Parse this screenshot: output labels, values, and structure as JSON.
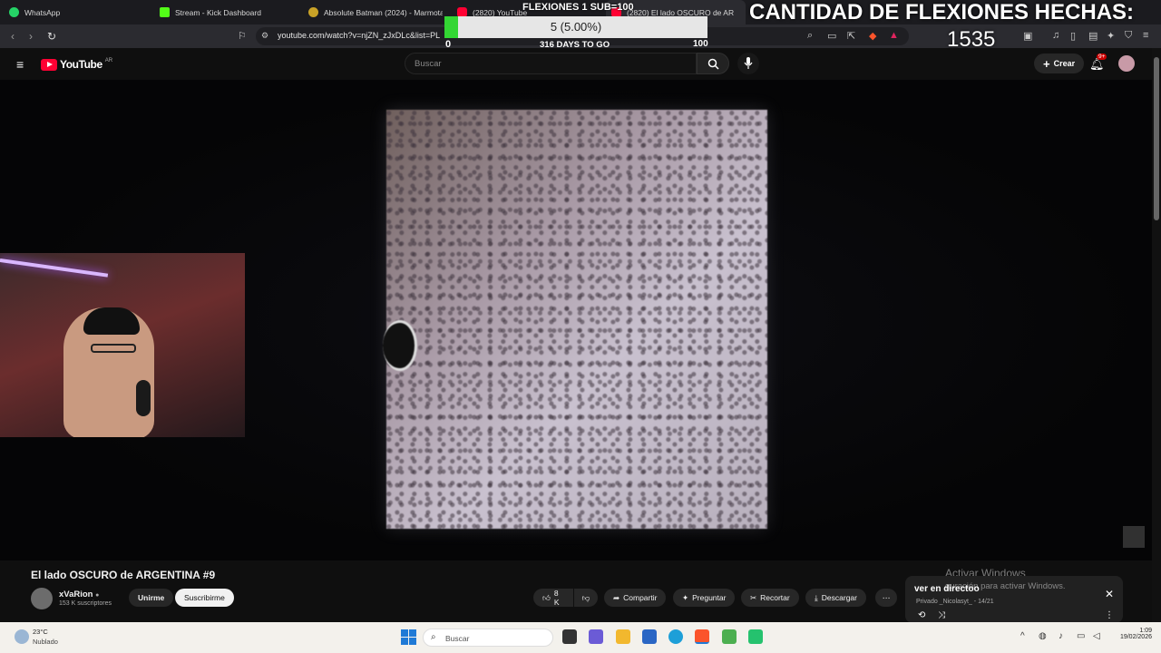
{
  "browser": {
    "tabs": [
      {
        "label": "WhatsApp",
        "color": "#25d366",
        "active": false
      },
      {
        "label": "Stream - Kick Dashboard",
        "color": "#53fc18",
        "active": false
      },
      {
        "label": "Absolute Batman (2024) - Marmota",
        "color": "#c9a227",
        "active": false
      },
      {
        "label": "(2820) YouTube",
        "color": "#ff0033",
        "active": false
      },
      {
        "label": "(2820) El lado OSCURO de AR",
        "color": "#ff0033",
        "active": true
      }
    ],
    "tab_close": "✕",
    "url": "youtube.com/watch?v=njZN_zJxDLc&list=PL",
    "nav": {
      "back": "‹",
      "forward": "›",
      "reload": "↻"
    }
  },
  "youtube": {
    "logo_text": "YouTube",
    "region": "AR",
    "search_placeholder": "Buscar",
    "create_label": "Crear",
    "notif_badge": "9+"
  },
  "overlay": {
    "goal_title": "FLEXIONES 1 SUB=100",
    "goal_count_text": "5 (5.00%)",
    "goal_progress": 0.05,
    "goal_min": "0",
    "goal_max": "100",
    "days_left": "316 DAYS TO GO",
    "pushups_title": "CANTIDAD DE FLEXIONES HECHAS:",
    "pushups_count": "1535",
    "accent": "#33d633"
  },
  "video": {
    "title": "El lado OSCURO de ARGENTINA #9",
    "channel": "xVaRion",
    "subscribers": "153 K suscriptores",
    "join_label": "Unirme",
    "subscribe_label": "Suscribirme",
    "likes": "8 K",
    "share_label": "Compartir",
    "ask_label": "Preguntar",
    "clip_label": "Recortar",
    "download_label": "Descargar"
  },
  "notification": {
    "title": "ver en directoo",
    "subtitle": "Privado  _Nicolasyt_ - 14/21"
  },
  "watermark": {
    "line1": "Activar Windows",
    "line2": "guración para activar Windows."
  },
  "taskbar": {
    "temperature": "23°C",
    "condition": "Nublado",
    "search_placeholder": "Buscar",
    "time": "1:09",
    "date": "19/02/2026"
  }
}
